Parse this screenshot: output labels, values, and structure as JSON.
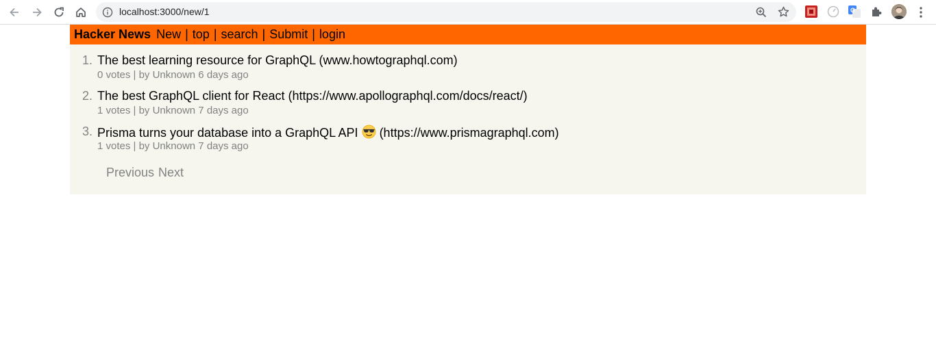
{
  "browser": {
    "url": "localhost:3000/new/1",
    "icons": [
      "back-arrow-icon",
      "forward-arrow-icon",
      "reload-icon",
      "home-icon",
      "info-icon",
      "zoom-icon",
      "star-icon",
      "extensions-icon",
      "menu-icon"
    ]
  },
  "header": {
    "brand": "Hacker News",
    "nav": [
      "New",
      "top",
      "search",
      "Submit",
      "login"
    ],
    "separator": "|",
    "color": "#ff6600"
  },
  "links": [
    {
      "rank": "1.",
      "title": "The best learning resource for GraphQL (www.howtographql.com)",
      "meta": "0 votes | by Unknown 6 days ago"
    },
    {
      "rank": "2.",
      "title": "The best GraphQL client for React (https://www.apollographql.com/docs/react/)",
      "meta": "1 votes | by Unknown 7 days ago"
    },
    {
      "rank": "3.",
      "title_before": "Prisma turns your database into a GraphQL API",
      "title_after": "(https://www.prismagraphql.com)",
      "meta": "1 votes | by Unknown 7 days ago"
    }
  ],
  "pager": {
    "previous": "Previous",
    "next": "Next"
  }
}
